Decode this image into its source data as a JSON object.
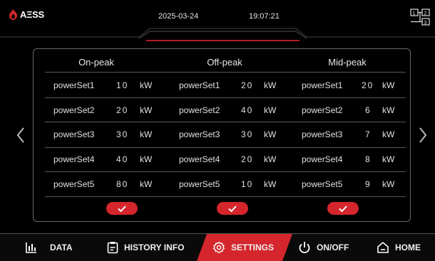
{
  "header": {
    "brand": "AΞSS",
    "date": "2025-03-24",
    "time": "19:07:21",
    "topology_badges": [
      "1",
      "2",
      "3"
    ]
  },
  "columns": [
    {
      "title": "On-peak",
      "rows": [
        {
          "label": "powerSet1",
          "value": "10",
          "unit": "kW"
        },
        {
          "label": "powerSet2",
          "value": "20",
          "unit": "kW"
        },
        {
          "label": "powerSet3",
          "value": "30",
          "unit": "kW"
        },
        {
          "label": "powerSet4",
          "value": "40",
          "unit": "kW"
        },
        {
          "label": "powerSet5",
          "value": "80",
          "unit": "kW"
        }
      ]
    },
    {
      "title": "Off-peak",
      "rows": [
        {
          "label": "powerSet1",
          "value": "20",
          "unit": "kW"
        },
        {
          "label": "powerSet2",
          "value": "40",
          "unit": "kW"
        },
        {
          "label": "powerSet3",
          "value": "30",
          "unit": "kW"
        },
        {
          "label": "powerSet4",
          "value": "20",
          "unit": "kW"
        },
        {
          "label": "powerSet5",
          "value": "10",
          "unit": "kW"
        }
      ]
    },
    {
      "title": "Mid-peak",
      "rows": [
        {
          "label": "powerSet1",
          "value": "20",
          "unit": "kW"
        },
        {
          "label": "powerSet2",
          "value": "6",
          "unit": "kW"
        },
        {
          "label": "powerSet3",
          "value": "7",
          "unit": "kW"
        },
        {
          "label": "powerSet4",
          "value": "8",
          "unit": "kW"
        },
        {
          "label": "powerSet5",
          "value": "9",
          "unit": "kW"
        }
      ]
    }
  ],
  "nav": {
    "data": "DATA",
    "history": "HISTORY INFO",
    "settings": "SETTINGS",
    "onoff": "ON/OFF",
    "home": "HOME"
  },
  "colors": {
    "accent": "#d4262c",
    "background": "#000000"
  },
  "icons": {
    "logo": "flame-logo-icon",
    "topology": "topology-icon",
    "confirm": "checkmark-icon",
    "prev": "chevron-left-icon",
    "next": "chevron-right-icon",
    "data": "bar-chart-icon",
    "history": "clipboard-icon",
    "settings": "gear-icon",
    "onoff": "power-icon",
    "home": "home-icon"
  }
}
